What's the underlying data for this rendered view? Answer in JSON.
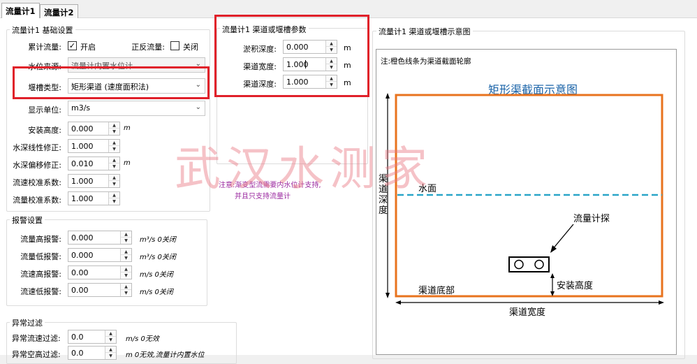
{
  "tabs": [
    "流量计1",
    "流量计2"
  ],
  "basic": {
    "title": "流量计1 基础设置",
    "accumulate_label": "累计流量:",
    "accumulate_check": "✓",
    "accumulate_value": "开启",
    "bidirectional_label": "正反流量:",
    "bidirectional_check": "",
    "bidirectional_value": "关闭",
    "level_source_label": "水位来源:",
    "level_source_value": "流量计内置水位计",
    "weir_type_label": "堰槽类型:",
    "weir_type_value": "矩形渠道 (速度面积法)",
    "unit_label": "显示单位:",
    "unit_value": "m3/s",
    "fields": [
      {
        "label": "安装高度:",
        "value": "0.000",
        "unit": "m"
      },
      {
        "label": "水深线性修正:",
        "value": "1.000",
        "unit": ""
      },
      {
        "label": "水深偏移修正:",
        "value": "0.010",
        "unit": "m"
      },
      {
        "label": "流速校准系数:",
        "value": "1.000",
        "unit": ""
      },
      {
        "label": "流量校准系数:",
        "value": "1.000",
        "unit": ""
      }
    ]
  },
  "alarm": {
    "title": "报警设置",
    "fields": [
      {
        "label": "流量高报警:",
        "value": "0.000",
        "unit": "m³/s 0关闭"
      },
      {
        "label": "流量低报警:",
        "value": "0.000",
        "unit": "m³/s 0关闭"
      },
      {
        "label": "流速高报警:",
        "value": "0.00",
        "unit": "m/s 0关闭"
      },
      {
        "label": "流速低报警:",
        "value": "0.00",
        "unit": "m/s 0关闭"
      }
    ]
  },
  "filter": {
    "title": "异常过滤",
    "fields": [
      {
        "label": "异常流速过滤:",
        "value": "0.0",
        "unit": "m/s 0无效"
      },
      {
        "label": "异常空高过滤:",
        "value": "0.0",
        "unit": "m 0无效,流量计内置水位"
      }
    ]
  },
  "channel": {
    "title": "流量计1 渠道或堰槽参数",
    "fields": [
      {
        "label": "淤积深度:",
        "value": "0.000",
        "unit": "m"
      },
      {
        "label": "渠道宽度:",
        "value": "1.000",
        "unit": "m"
      },
      {
        "label": "渠道深度:",
        "value": "1.000",
        "unit": "m"
      }
    ],
    "note_line1": "注意:渐变型流需要内水位计支持,",
    "note_line2": "并且只支持流量计"
  },
  "diagram": {
    "title": "流量计1 渠道或堰槽示意图",
    "note": "注:橙色线条为渠道截面轮廓",
    "heading": "矩形渠截面示意图",
    "depth_label": [
      "渠",
      "道",
      "深",
      "度"
    ],
    "water_label": "水面",
    "probe_label": "流量计探",
    "bottom_label": "渠道底部",
    "install_label": "安装高度",
    "width_label": "渠道宽度"
  },
  "watermark": "武汉水测家",
  "colors": {
    "highlight": "#e0202a",
    "outline": "#e8731e",
    "water": "#2aa6c8",
    "heading": "#1a63a8",
    "note": "#9b2aa0"
  }
}
